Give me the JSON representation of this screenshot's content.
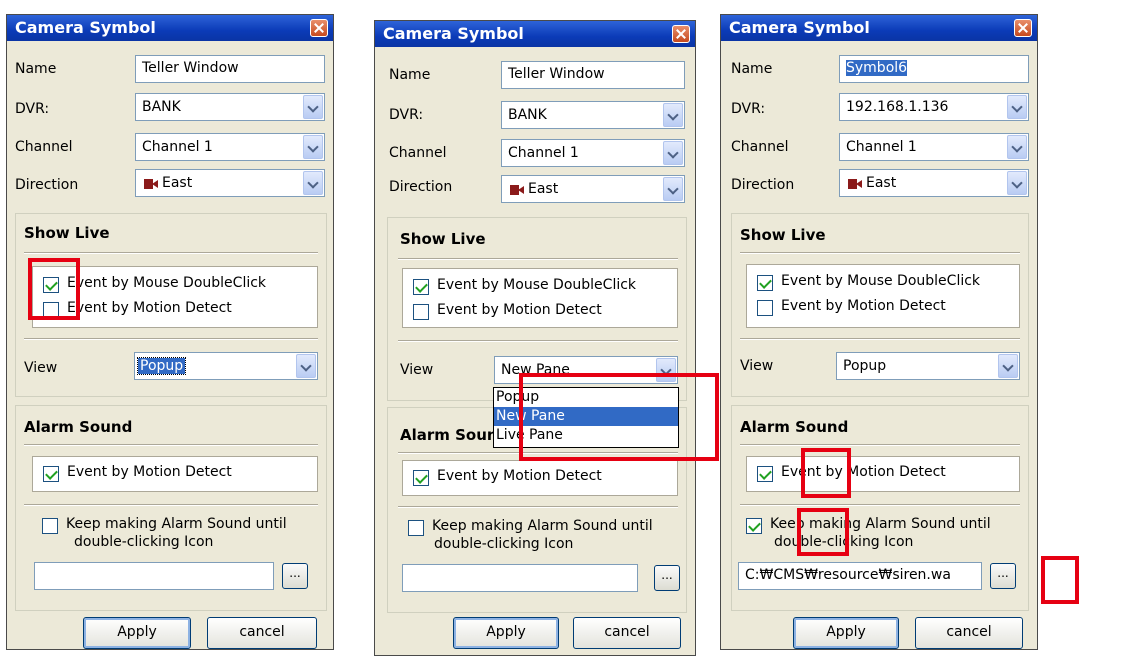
{
  "dialogs": [
    {
      "title": "Camera Symbol",
      "name_label": "Name",
      "name_value": "Teller Window",
      "dvr_label": "DVR:",
      "dvr_value": "BANK",
      "channel_label": "Channel",
      "channel_value": "Channel 1",
      "direction_label": "Direction",
      "direction_value": "East",
      "show_live_title": "Show Live",
      "event_mouse": "Event by Mouse DoubleClick",
      "event_mouse_checked": true,
      "event_motion": "Event by Motion Detect",
      "event_motion_checked": false,
      "view_label": "View",
      "view_value": "Popup",
      "alarm_title": "Alarm Sound",
      "alarm_motion": "Event by Motion Detect",
      "alarm_motion_checked": true,
      "keep_line1": "Keep making Alarm Sound until",
      "keep_line2": "double-clicking Icon",
      "keep_checked": false,
      "sound_path": "",
      "browse_label": "...",
      "apply_label": "Apply",
      "cancel_label": "cancel"
    },
    {
      "title": "Camera Symbol",
      "name_label": "Name",
      "name_value": "Teller Window",
      "dvr_label": "DVR:",
      "dvr_value": "BANK",
      "channel_label": "Channel",
      "channel_value": "Channel 1",
      "direction_label": "Direction",
      "direction_value": "East",
      "show_live_title": "Show Live",
      "event_mouse": "Event by Mouse DoubleClick",
      "event_mouse_checked": true,
      "event_motion": "Event by Motion Detect",
      "event_motion_checked": false,
      "view_label": "View",
      "view_value": "New Pane",
      "view_options": [
        "Popup",
        "New Pane",
        "Live Pane"
      ],
      "view_selected_option": "New Pane",
      "alarm_title": "Alarm Sound",
      "alarm_motion": "Event by Motion Detect",
      "alarm_motion_checked": true,
      "keep_line1": "Keep making Alarm Sound until",
      "keep_line2": "double-clicking Icon",
      "keep_checked": false,
      "sound_path": "",
      "browse_label": "...",
      "apply_label": "Apply",
      "cancel_label": "cancel"
    },
    {
      "title": "Camera Symbol",
      "name_label": "Name",
      "name_value": "Symbol6",
      "dvr_label": "DVR:",
      "dvr_value": "192.168.1.136",
      "channel_label": "Channel",
      "channel_value": "Channel 1",
      "direction_label": "Direction",
      "direction_value": "East",
      "show_live_title": "Show Live",
      "event_mouse": "Event by Mouse DoubleClick",
      "event_mouse_checked": true,
      "event_motion": "Event by Motion Detect",
      "event_motion_checked": false,
      "view_label": "View",
      "view_value": "Popup",
      "alarm_title": "Alarm Sound",
      "alarm_motion": "Event by Motion Detect",
      "alarm_motion_checked": true,
      "keep_line1": "Keep making Alarm Sound until",
      "keep_line2": "double-clicking Icon",
      "keep_checked": true,
      "sound_path": "C:₩CMS₩resource₩siren.wa",
      "browse_label": "...",
      "apply_label": "Apply",
      "cancel_label": "cancel"
    }
  ],
  "colors": {
    "annotation_red": "#e60012",
    "titlebar_blue": "#0b3bb8",
    "dialog_bg": "#ece9d8",
    "selection_blue": "#316ac5"
  }
}
